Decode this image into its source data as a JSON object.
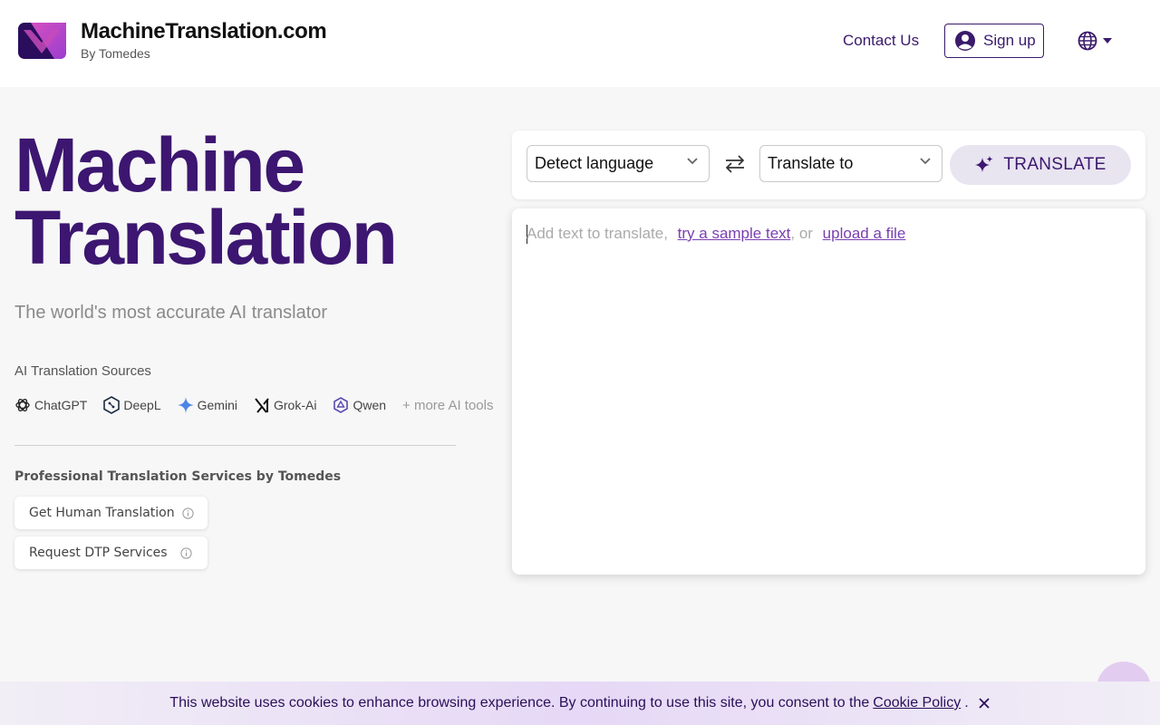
{
  "header": {
    "brand_name": "MachineTranslation.com",
    "brand_sub": "By Tomedes",
    "contact": "Contact Us",
    "signup": "Sign up"
  },
  "hero": {
    "title_line1": "Machine",
    "title_line2": "Translation",
    "subtitle": "The world's most accurate AI translator"
  },
  "sources": {
    "label": "AI Translation Sources",
    "items": [
      "ChatGPT",
      "DeepL",
      "Gemini",
      "Grok-Ai",
      "Qwen"
    ],
    "more": "+ more AI tools"
  },
  "pro": {
    "label": "Professional Translation Services by Tomedes",
    "human": "Get Human Translation",
    "dtp": "Request DTP Services"
  },
  "toolbar": {
    "source_lang": "Detect language",
    "target_lang": "Translate to",
    "translate": "TRANSLATE"
  },
  "editor": {
    "placeholder": "Add text to translate,",
    "sample_link": "try a sample text",
    "or_text": ", or",
    "upload_link": "upload a file"
  },
  "cookie": {
    "message": "This website uses cookies to enhance browsing experience. By continuing to use this site, you consent to the",
    "policy_link": "Cookie Policy",
    "period": "."
  },
  "colors": {
    "brand_purple": "#3c1670",
    "link_purple": "#7a3fb0",
    "translate_bg": "#e8e4f0"
  }
}
